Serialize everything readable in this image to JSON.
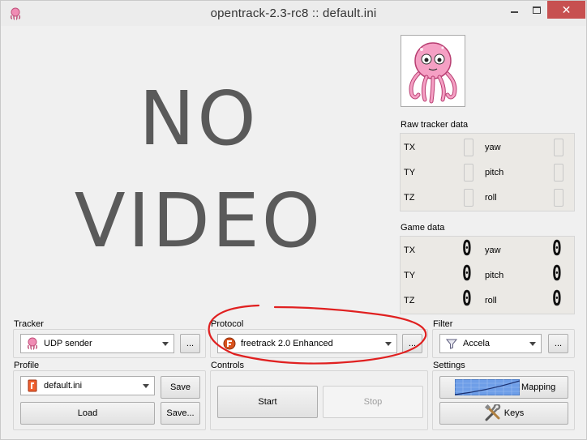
{
  "window": {
    "title": "opentrack-2.3-rc8 :: default.ini",
    "close_glyph": "✕"
  },
  "video": {
    "line1": "NO",
    "line2": "VIDEO"
  },
  "raw_tracker": {
    "label": "Raw tracker data",
    "rows": [
      {
        "left": "TX",
        "right": "yaw"
      },
      {
        "left": "TY",
        "right": "pitch"
      },
      {
        "left": "TZ",
        "right": "roll"
      }
    ]
  },
  "game_data": {
    "label": "Game data",
    "rows": [
      {
        "left": "TX",
        "right": "yaw",
        "left_value": "0",
        "right_value": "0"
      },
      {
        "left": "TY",
        "right": "pitch",
        "left_value": "0",
        "right_value": "0"
      },
      {
        "left": "TZ",
        "right": "roll",
        "left_value": "0",
        "right_value": "0"
      }
    ]
  },
  "tracker": {
    "label": "Tracker",
    "selected": "UDP sender",
    "icon": "octopus-icon",
    "more_label": "..."
  },
  "protocol": {
    "label": "Protocol",
    "selected": "freetrack 2.0 Enhanced",
    "icon": "freetrack-icon",
    "more_label": "..."
  },
  "filter": {
    "label": "Filter",
    "selected": "Accela",
    "icon": "funnel-icon",
    "more_label": "..."
  },
  "profile": {
    "label": "Profile",
    "selected": "default.ini",
    "icon": "profile-icon",
    "save_label": "Save",
    "load_label": "Load",
    "save_as_label": "Save..."
  },
  "controls": {
    "label": "Controls",
    "start_label": "Start",
    "stop_label": "Stop"
  },
  "settings": {
    "label": "Settings",
    "mapping_label": "Mapping",
    "keys_label": "Keys"
  },
  "colors": {
    "annotation": "#e02020",
    "close_button": "#c75050",
    "logo_pink": "#f08cb4"
  }
}
